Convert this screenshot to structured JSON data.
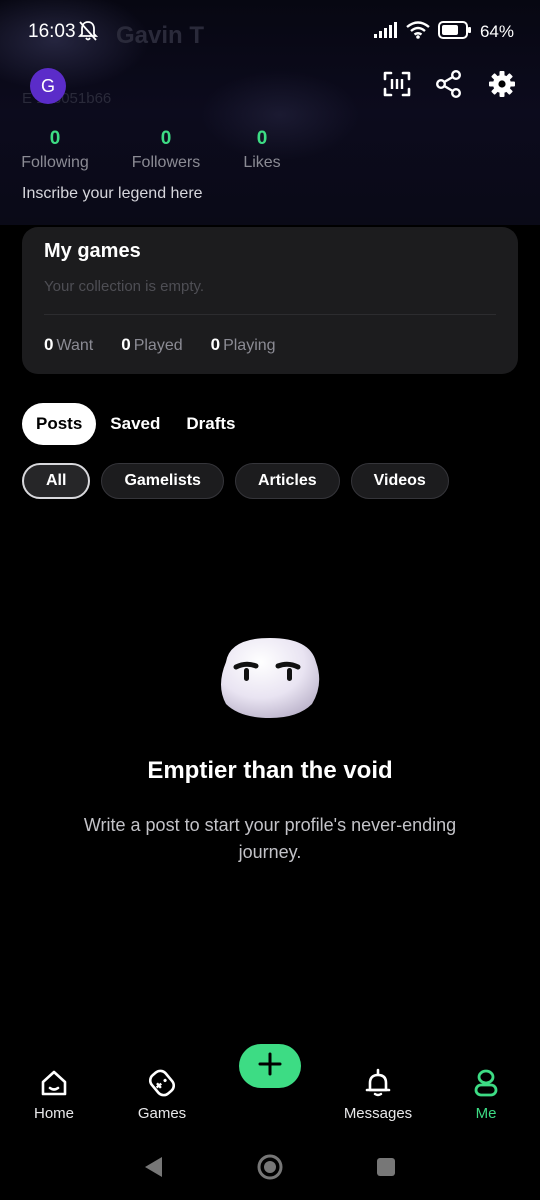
{
  "status_bar": {
    "time": "16:03",
    "battery": "64"
  },
  "profile": {
    "avatar_letter": "G",
    "name": "Gavin T",
    "user_id": "E 1ab051b66",
    "stats": [
      {
        "value": "0",
        "label": "Following"
      },
      {
        "value": "0",
        "label": "Followers"
      },
      {
        "value": "0",
        "label": "Likes"
      }
    ],
    "bio": "Inscribe your legend here"
  },
  "my_games": {
    "title": "My games",
    "empty_text": "Your collection is empty.",
    "counts": [
      {
        "value": "0",
        "label": "Want"
      },
      {
        "value": "0",
        "label": "Played"
      },
      {
        "value": "0",
        "label": "Playing"
      }
    ]
  },
  "tabs": [
    {
      "label": "Posts",
      "active": true
    },
    {
      "label": "Saved",
      "active": false
    },
    {
      "label": "Drafts",
      "active": false
    }
  ],
  "filters": [
    {
      "label": "All",
      "active": true
    },
    {
      "label": "Gamelists",
      "active": false
    },
    {
      "label": "Articles",
      "active": false
    },
    {
      "label": "Videos",
      "active": false
    }
  ],
  "empty_state": {
    "title": "Emptier than the void",
    "description": "Write a post to start your profile's never-ending journey."
  },
  "bottom_nav": [
    {
      "label": "Home",
      "icon": "home-icon",
      "active": false
    },
    {
      "label": "Games",
      "icon": "gamepad-icon",
      "active": false
    },
    {
      "label": "Messages",
      "icon": "bell-icon",
      "active": false
    },
    {
      "label": "Me",
      "icon": "user-icon",
      "active": true
    }
  ],
  "colors": {
    "accent": "#3ddc84",
    "avatar": "#5b2cc9",
    "card": "#1c1c1e"
  }
}
